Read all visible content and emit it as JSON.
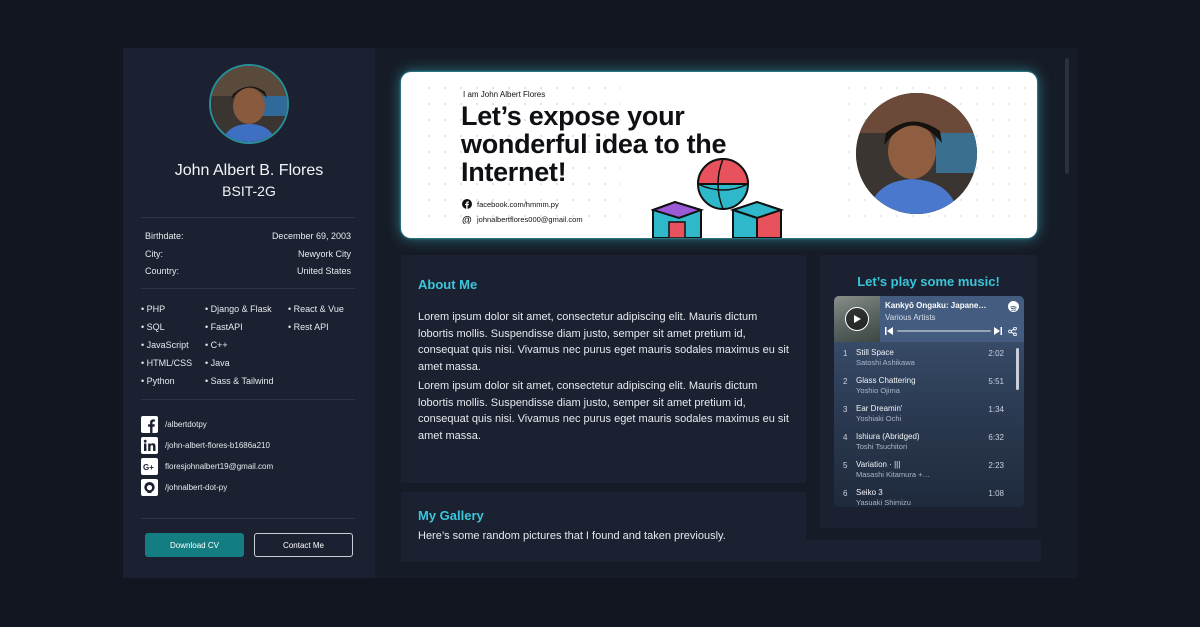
{
  "profile": {
    "name": "John Albert B. Flores",
    "course": "BSIT-2G",
    "info": [
      {
        "label": "Birthdate:",
        "value": "December 69, 2003"
      },
      {
        "label": "City:",
        "value": "Newyork City"
      },
      {
        "label": "Country:",
        "value": "United States"
      }
    ],
    "skills": [
      "PHP",
      "Django & Flask",
      "React & Vue",
      "SQL",
      "FastAPI",
      "Rest API",
      "JavaScript",
      "C++",
      "HTML/CSS",
      "Java",
      "Python",
      "Sass & Tailwind"
    ],
    "socials": [
      {
        "icon": "facebook-icon",
        "text": "/albertdotpy"
      },
      {
        "icon": "linkedin-icon",
        "text": "/john-albert-flores-b1686a210"
      },
      {
        "icon": "google-plus-icon",
        "text": "floresjohnalbert19@gmail.com"
      },
      {
        "icon": "github-icon",
        "text": "/johnalbert-dot-py"
      }
    ],
    "download_label": "Download CV",
    "contact_label": "Contact Me"
  },
  "hero": {
    "intro": "I am John Albert Flores",
    "title": "Let’s expose your wonderful idea to the Internet!",
    "facebook": "facebook.com/hmmm.py",
    "email": "johnalbertflores000@gmail.com"
  },
  "about": {
    "title": "About Me",
    "p1": "Lorem ipsum dolor sit amet, consectetur adipiscing elit. Mauris dictum lobortis mollis. Suspendisse diam justo, semper sit amet pretium id, consequat quis nisi. Vivamus nec purus eget mauris sodales maximus eu sit amet massa.",
    "p2": "Lorem ipsum dolor sit amet, consectetur adipiscing elit. Mauris dictum lobortis mollis. Suspendisse diam justo, semper sit amet pretium id, consequat quis nisi. Vivamus nec purus eget mauris sodales maximus eu sit amet massa."
  },
  "gallery": {
    "title": "My Gallery",
    "desc": "Here’s some random pictures that I found and taken previously."
  },
  "music": {
    "title": "Let’s play some music!",
    "album": "Kankyō Ongaku: Japane…",
    "artist": "Various Artists",
    "tracks": [
      {
        "n": "1",
        "title": "Still Space",
        "artist": "Satoshi Ashikawa",
        "dur": "2:02"
      },
      {
        "n": "2",
        "title": "Glass Chattering",
        "artist": "Yoshio Ojima",
        "dur": "5:51"
      },
      {
        "n": "3",
        "title": "Ear Dreamin'",
        "artist": "Yoshiaki Ochi",
        "dur": "1:34"
      },
      {
        "n": "4",
        "title": "Ishiura (Abridged)",
        "artist": "Toshi Tsuchitori",
        "dur": "6:32"
      },
      {
        "n": "5",
        "title": "Variation · |||",
        "artist": "Masashi Kitamura +…",
        "dur": "2:23"
      },
      {
        "n": "6",
        "title": "Seiko 3",
        "artist": "Yasuaki Shimizu",
        "dur": "1:08"
      }
    ]
  },
  "colors": {
    "accent": "#3ac6db",
    "button": "#137d82",
    "background": "#111620",
    "panel": "#1b2130"
  }
}
